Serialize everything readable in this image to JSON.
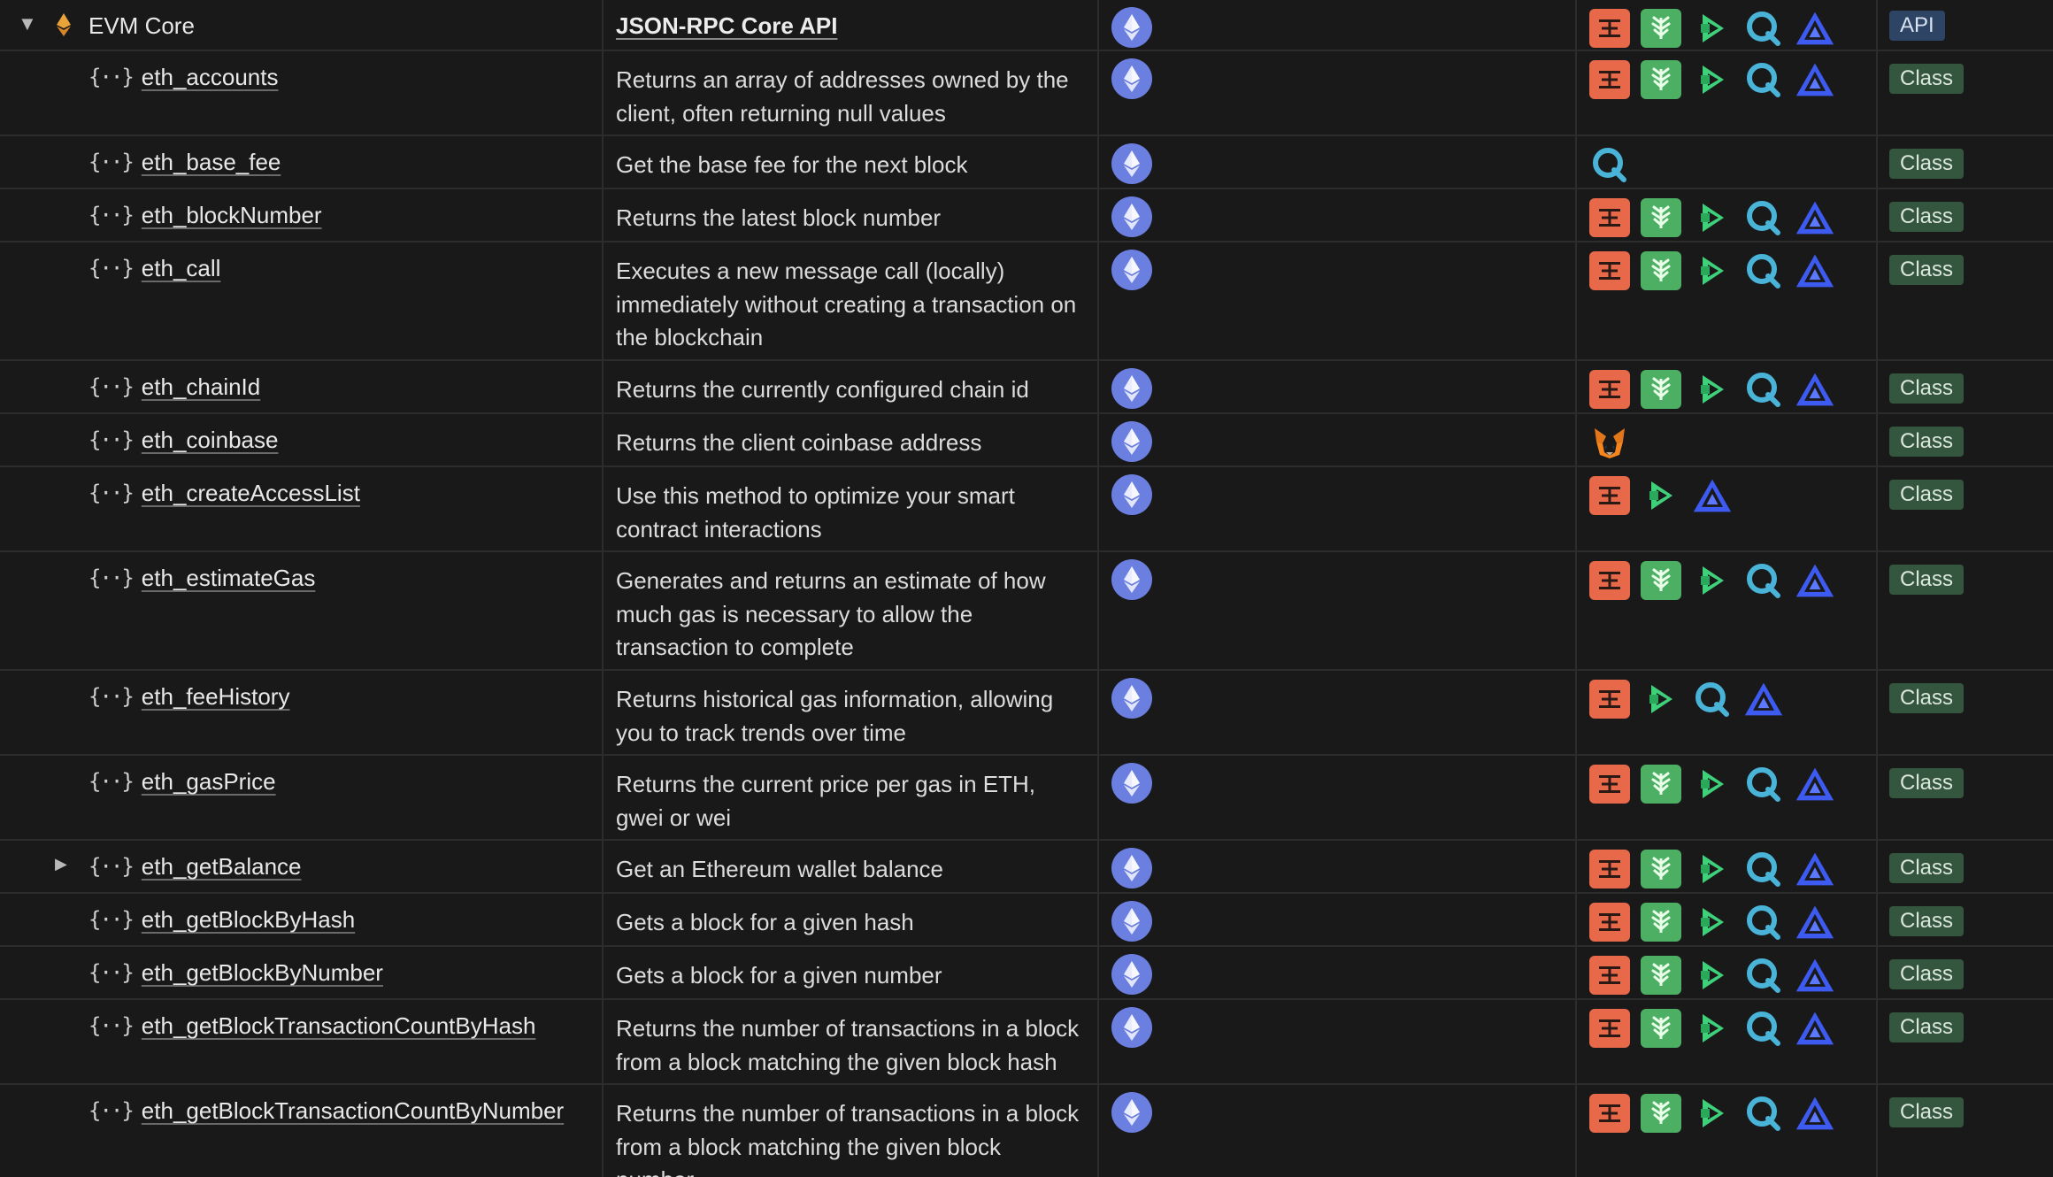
{
  "group": {
    "title": "EVM Core",
    "description": "JSON-RPC Core API",
    "tag": "API",
    "providers": [
      "tatum-icon",
      "chainstack-icon",
      "getblock-icon",
      "quicknode-icon",
      "alchemy-icon"
    ]
  },
  "rows": [
    {
      "name": "eth_accounts",
      "desc": [
        "Returns an array of addresses owned by the",
        "client, often returning null values"
      ],
      "providers": [
        "tatum-icon",
        "chainstack-icon",
        "getblock-icon",
        "quicknode-icon",
        "alchemy-icon"
      ],
      "tag": "Class",
      "expandable": false
    },
    {
      "name": "eth_base_fee",
      "desc": [
        "Get the base fee for the next block"
      ],
      "providers": [
        "quicknode-icon"
      ],
      "tag": "Class",
      "expandable": false
    },
    {
      "name": "eth_blockNumber",
      "desc": [
        "Returns the latest block number"
      ],
      "providers": [
        "tatum-icon",
        "chainstack-icon",
        "getblock-icon",
        "quicknode-icon",
        "alchemy-icon"
      ],
      "tag": "Class",
      "expandable": false
    },
    {
      "name": "eth_call",
      "desc": [
        "Executes a new message call (locally)",
        "immediately without creating a transaction on",
        "the blockchain"
      ],
      "providers": [
        "tatum-icon",
        "chainstack-icon",
        "getblock-icon",
        "quicknode-icon",
        "alchemy-icon"
      ],
      "tag": "Class",
      "expandable": false
    },
    {
      "name": "eth_chainId",
      "desc": [
        "Returns the currently configured chain id"
      ],
      "providers": [
        "tatum-icon",
        "chainstack-icon",
        "getblock-icon",
        "quicknode-icon",
        "alchemy-icon"
      ],
      "tag": "Class",
      "expandable": false
    },
    {
      "name": "eth_coinbase",
      "desc": [
        "Returns the client coinbase address"
      ],
      "providers": [
        "metamask-icon"
      ],
      "tag": "Class",
      "expandable": false
    },
    {
      "name": "eth_createAccessList",
      "desc": [
        "Use this method to optimize your smart",
        "contract interactions"
      ],
      "providers": [
        "tatum-icon",
        "getblock-icon",
        "alchemy-icon"
      ],
      "tag": "Class",
      "expandable": false
    },
    {
      "name": "eth_estimateGas",
      "desc": [
        "Generates and returns an estimate of how",
        "much gas is necessary to allow the",
        "transaction to complete"
      ],
      "providers": [
        "tatum-icon",
        "chainstack-icon",
        "getblock-icon",
        "quicknode-icon",
        "alchemy-icon"
      ],
      "tag": "Class",
      "expandable": false
    },
    {
      "name": "eth_feeHistory",
      "desc": [
        "Returns historical gas information, allowing",
        "you to track trends over time"
      ],
      "providers": [
        "tatum-icon",
        "getblock-icon",
        "quicknode-icon",
        "alchemy-icon"
      ],
      "tag": "Class",
      "expandable": false
    },
    {
      "name": "eth_gasPrice",
      "desc": [
        "Returns the current price per gas in ETH,",
        "gwei or wei"
      ],
      "providers": [
        "tatum-icon",
        "chainstack-icon",
        "getblock-icon",
        "quicknode-icon",
        "alchemy-icon"
      ],
      "tag": "Class",
      "expandable": false
    },
    {
      "name": "eth_getBalance",
      "desc": [
        "Get an Ethereum wallet balance"
      ],
      "providers": [
        "tatum-icon",
        "chainstack-icon",
        "getblock-icon",
        "quicknode-icon",
        "alchemy-icon"
      ],
      "tag": "Class",
      "expandable": true
    },
    {
      "name": "eth_getBlockByHash",
      "desc": [
        "Gets a block for a given hash"
      ],
      "providers": [
        "tatum-icon",
        "chainstack-icon",
        "getblock-icon",
        "quicknode-icon",
        "alchemy-icon"
      ],
      "tag": "Class",
      "expandable": false
    },
    {
      "name": "eth_getBlockByNumber",
      "desc": [
        "Gets a block for a given number"
      ],
      "providers": [
        "tatum-icon",
        "chainstack-icon",
        "getblock-icon",
        "quicknode-icon",
        "alchemy-icon"
      ],
      "tag": "Class",
      "expandable": false
    },
    {
      "name": "eth_getBlockTransactionCountByHash",
      "desc": [
        "Returns the number of transactions in a block",
        "from a block matching the given block hash"
      ],
      "providers": [
        "tatum-icon",
        "chainstack-icon",
        "getblock-icon",
        "quicknode-icon",
        "alchemy-icon"
      ],
      "tag": "Class",
      "expandable": false
    },
    {
      "name": "eth_getBlockTransactionCountByNumber",
      "desc": [
        "Returns the number of transactions in a block",
        "from a block matching the given block",
        "number"
      ],
      "providers": [
        "tatum-icon",
        "chainstack-icon",
        "getblock-icon",
        "quicknode-icon",
        "alchemy-icon"
      ],
      "tag": "Class",
      "expandable": false
    }
  ],
  "colors": {
    "background": "#191919",
    "tatum": "#e8684a",
    "chainstack": "#4caf63",
    "getblock": "#3fd07a",
    "quicknode": "#4ab3d8",
    "alchemy": "#3d5af1",
    "ethereum": "#6b7fe0",
    "class_tag": "#34553e",
    "api_tag": "#2d4465"
  }
}
